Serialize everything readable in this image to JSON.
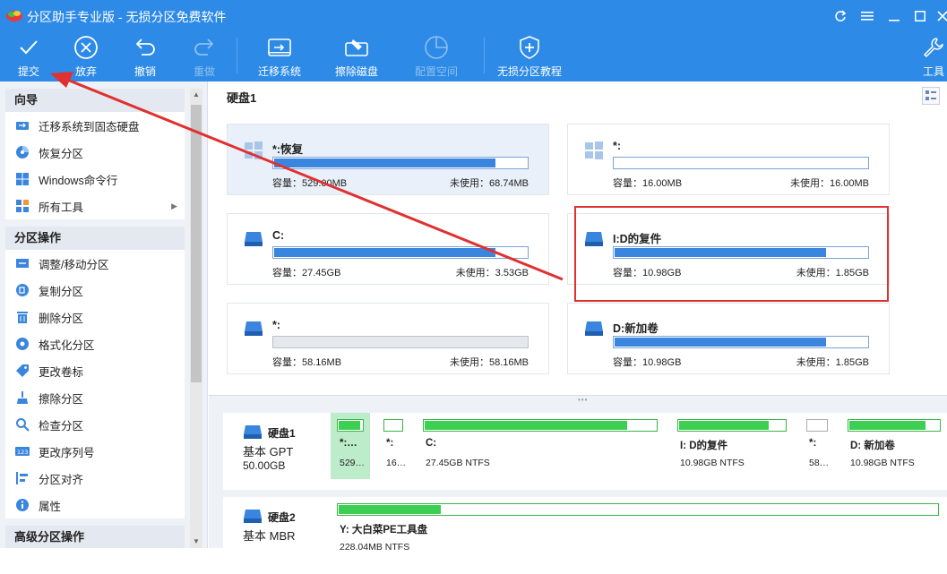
{
  "window": {
    "title": "分区助手专业版 - 无损分区免费软件",
    "controls": [
      "refresh-icon",
      "menu-icon",
      "minimize-icon",
      "maximize-icon",
      "close-icon"
    ]
  },
  "toolbar": {
    "items": [
      {
        "label": "提交",
        "icon": "checkmark-icon",
        "enabled": true
      },
      {
        "label": "放弃",
        "icon": "cancel-circle-icon",
        "enabled": true
      },
      {
        "label": "撤销",
        "icon": "undo-icon",
        "enabled": true
      },
      {
        "label": "重做",
        "icon": "redo-icon",
        "enabled": false
      },
      {
        "label": "迁移系统",
        "icon": "migrate-disk-icon",
        "enabled": true
      },
      {
        "label": "擦除磁盘",
        "icon": "wipe-disk-icon",
        "enabled": true
      },
      {
        "label": "配置空间",
        "icon": "pie-icon",
        "enabled": false
      },
      {
        "label": "无损分区教程",
        "icon": "shield-plus-icon",
        "enabled": true
      },
      {
        "label": "工具",
        "icon": "wrench-icon",
        "enabled": true
      }
    ]
  },
  "sidebar": {
    "wizard": {
      "header": "向导",
      "items": [
        {
          "label": "迁移系统到固态硬盘",
          "icon": "migrate-icon"
        },
        {
          "label": "恢复分区",
          "icon": "recover-icon"
        },
        {
          "label": "Windows命令行",
          "icon": "windows-icon"
        },
        {
          "label": "所有工具",
          "icon": "all-tools-icon",
          "has_submenu": true
        }
      ]
    },
    "partition_ops": {
      "header": "分区操作",
      "items": [
        {
          "label": "调整/移动分区",
          "icon": "resize-icon"
        },
        {
          "label": "复制分区",
          "icon": "copy-icon"
        },
        {
          "label": "删除分区",
          "icon": "trash-icon"
        },
        {
          "label": "格式化分区",
          "icon": "format-icon"
        },
        {
          "label": "更改卷标",
          "icon": "tag-icon"
        },
        {
          "label": "擦除分区",
          "icon": "wipe-icon"
        },
        {
          "label": "检查分区",
          "icon": "check-icon"
        },
        {
          "label": "更改序列号",
          "icon": "serial-icon"
        },
        {
          "label": "分区对齐",
          "icon": "align-icon"
        },
        {
          "label": "属性",
          "icon": "info-icon"
        }
      ]
    },
    "partial_next_header": "高级分区操作"
  },
  "main": {
    "disk_title": "硬盘1",
    "cards": [
      {
        "name": "*:恢复",
        "icon": "windows-icon",
        "capacity": "容量：529.00MB",
        "free": "未使用：68.74MB",
        "used_fraction": 0.87,
        "selected": true
      },
      {
        "name": "*:",
        "icon": "windows-icon",
        "capacity": "容量：16.00MB",
        "free": "未使用：16.00MB",
        "used_fraction": 0.0,
        "selected": false
      },
      {
        "name": "C:",
        "icon": "drive-icon",
        "capacity": "容量：27.45GB",
        "free": "未使用：3.53GB",
        "used_fraction": 0.87,
        "selected": false
      },
      {
        "name": "I:D的复件",
        "icon": "drive-icon",
        "capacity": "容量：10.98GB",
        "free": "未使用：1.85GB",
        "used_fraction": 0.83,
        "selected": false
      },
      {
        "name": "*:",
        "icon": "drive-icon",
        "capacity": "容量：58.16MB",
        "free": "未使用：58.16MB",
        "used_fraction": 0.0,
        "selected": false,
        "gray": true
      },
      {
        "name": "D:新加卷",
        "icon": "drive-icon",
        "capacity": "容量：10.98GB",
        "free": "未使用：1.85GB",
        "used_fraction": 0.83,
        "selected": false
      }
    ]
  },
  "disk_map": {
    "disks": [
      {
        "name": "硬盘1",
        "type": "基本 GPT",
        "size": "50.00GB",
        "partitions": [
          {
            "name": "*:…",
            "size": "529…",
            "used_fraction": 0.87,
            "selected": true
          },
          {
            "name": "*:",
            "size": "16…",
            "used_fraction": 0.0,
            "gray": false
          },
          {
            "name": "C:",
            "size": "27.45GB NTFS",
            "used_fraction": 0.87
          },
          {
            "name": "I: D的复件",
            "size": "10.98GB NTFS",
            "used_fraction": 0.83
          },
          {
            "name": "*:",
            "size": "58…",
            "used_fraction": 0.0,
            "gray": true
          },
          {
            "name": "D: 新加卷",
            "size": "10.98GB NTFS",
            "used_fraction": 0.83
          }
        ]
      },
      {
        "name": "硬盘2",
        "type": "基本 MBR",
        "size": "",
        "partitions": [
          {
            "name": "Y: 大白菜PE工具盘",
            "size": "228.04MB NTFS",
            "used_fraction": 0.17
          }
        ]
      }
    ]
  },
  "colors": {
    "accent": "#2d8ae6",
    "usage_blue": "#3a86de",
    "usage_green": "#3ccf52",
    "annotation_red": "#e03030"
  }
}
